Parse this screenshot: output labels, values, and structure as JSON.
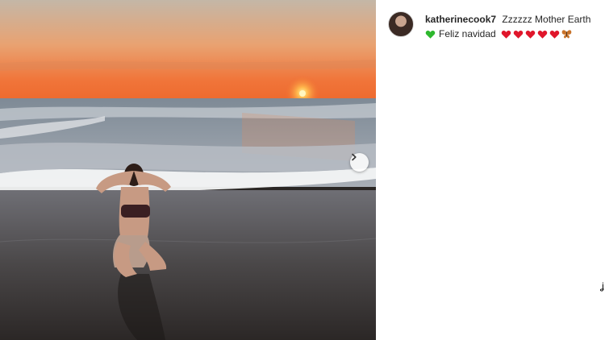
{
  "post": {
    "username": "katherinecook7",
    "caption_text": "Zzzzzz Mother Earth",
    "caption_line2_text": "Feliz navidad",
    "emojis": [
      "green-heart-icon",
      "red-heart-icon",
      "red-heart-icon",
      "red-heart-icon",
      "red-heart-icon",
      "red-heart-icon",
      "butterfly-icon"
    ]
  },
  "carousel": {
    "next_icon": "chevron-right-icon"
  },
  "colors": {
    "red_heart": "#e0162b",
    "green_heart": "#2eb82e",
    "butterfly": "#c8732a",
    "sun": "#ffcc33"
  },
  "edge_mark": "ʝ"
}
